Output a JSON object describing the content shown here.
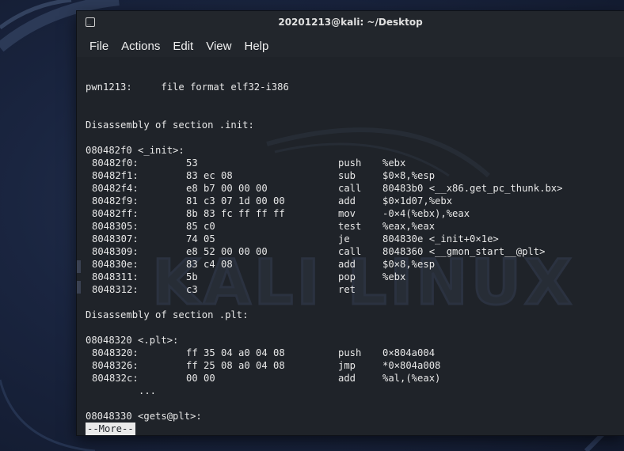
{
  "window": {
    "title": "20201213@kali: ~/Desktop",
    "menu": [
      "File",
      "Actions",
      "Edit",
      "View",
      "Help"
    ]
  },
  "terminal": {
    "header_line": "pwn1213:     file format elf32-i386",
    "section_init": "Disassembly of section .init:",
    "init_label": "080482f0 <_init>:",
    "init_rows": [
      {
        "addr": "80482f0:",
        "bytes": "53",
        "op": "push",
        "args": "%ebx"
      },
      {
        "addr": "80482f1:",
        "bytes": "83 ec 08",
        "op": "sub",
        "args": "$0×8,%esp"
      },
      {
        "addr": "80482f4:",
        "bytes": "e8 b7 00 00 00",
        "op": "call",
        "args": "80483b0 <__x86.get_pc_thunk.bx>"
      },
      {
        "addr": "80482f9:",
        "bytes": "81 c3 07 1d 00 00",
        "op": "add",
        "args": "$0×1d07,%ebx"
      },
      {
        "addr": "80482ff:",
        "bytes": "8b 83 fc ff ff ff",
        "op": "mov",
        "args": "-0×4(%ebx),%eax"
      },
      {
        "addr": "8048305:",
        "bytes": "85 c0",
        "op": "test",
        "args": "%eax,%eax"
      },
      {
        "addr": "8048307:",
        "bytes": "74 05",
        "op": "je",
        "args": "804830e <_init+0×1e>"
      },
      {
        "addr": "8048309:",
        "bytes": "e8 52 00 00 00",
        "op": "call",
        "args": "8048360 <__gmon_start__@plt>"
      },
      {
        "addr": "804830e:",
        "bytes": "83 c4 08",
        "op": "add",
        "args": "$0×8,%esp"
      },
      {
        "addr": "8048311:",
        "bytes": "5b",
        "op": "pop",
        "args": "%ebx"
      },
      {
        "addr": "8048312:",
        "bytes": "c3",
        "op": "ret",
        "args": ""
      }
    ],
    "section_plt": "Disassembly of section .plt:",
    "plt_label": "08048320 <.plt>:",
    "plt_rows": [
      {
        "addr": "8048320:",
        "bytes": "ff 35 04 a0 04 08",
        "op": "push",
        "args": "0×804a004"
      },
      {
        "addr": "8048326:",
        "bytes": "ff 25 08 a0 04 08",
        "op": "jmp",
        "args": "*0×804a008"
      },
      {
        "addr": "804832c:",
        "bytes": "00 00",
        "op": "add",
        "args": "%al,(%eax)"
      }
    ],
    "ellipsis": "...",
    "gets_label": "08048330 <gets@plt>:",
    "more_prompt": "--More--"
  }
}
